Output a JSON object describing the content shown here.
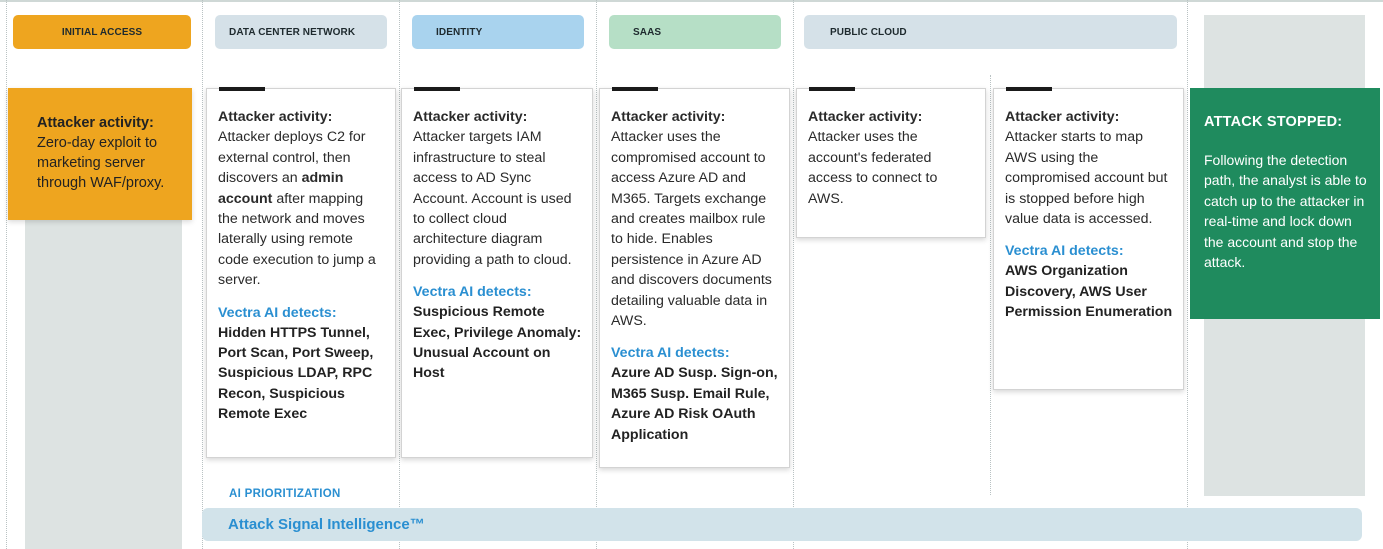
{
  "headers": [
    {
      "label": "INITIAL ACCESS",
      "color": "#eea51f"
    },
    {
      "label": "DATA CENTER NETWORK",
      "color": "#d5e1e8"
    },
    {
      "label": "IDENTITY",
      "color": "#a9d3ee"
    },
    {
      "label": "SAAS",
      "color": "#b6dfc6"
    },
    {
      "label": "PUBLIC CLOUD",
      "color": "#d5e1e8"
    }
  ],
  "initial_access": {
    "title": "Attacker activity:",
    "body": "Zero-day exploit to marketing server through WAF/proxy."
  },
  "data_center": {
    "title": "Attacker activity:",
    "body_1": "Attacker deploys C2 for external control, then discovers an ",
    "body_bold": "admin account",
    "body_2": " after mapping the network and moves laterally using remote code execution to jump a server.",
    "detect_label": "Vectra AI detects:",
    "detections": "Hidden HTTPS Tunnel, Port Scan, Port Sweep, Suspicious LDAP, RPC Recon, Suspicious Remote Exec"
  },
  "identity": {
    "title": "Attacker activity:",
    "body": "Attacker targets IAM infrastructure to steal access to AD Sync Account. Account is used to collect cloud architecture diagram providing a path to cloud.",
    "detect_label": "Vectra AI detects:",
    "detections": "Suspicious Remote Exec, Privilege Anomaly: Unusual Account on Host"
  },
  "saas": {
    "title": "Attacker activity:",
    "body": "Attacker uses the compromised account to access Azure AD and M365. Targets exchange and creates mailbox rule to hide. Enables persistence in Azure AD and discovers documents detailing valuable data in AWS.",
    "detect_label": "Vectra AI detects:",
    "detections": "Azure AD Susp. Sign-on, M365 Susp. Email Rule, Azure AD Risk OAuth Application"
  },
  "public_cloud_1": {
    "title": "Attacker activity:",
    "body": "Attacker uses the account's federated access to connect to AWS."
  },
  "public_cloud_2": {
    "title": "Attacker activity:",
    "body": "Attacker starts to map AWS using the compromised account but is stopped before high value data is accessed.",
    "detect_label": "Vectra AI detects:",
    "detections": "AWS Organization Discovery, AWS User Permission Enumeration"
  },
  "attack_stopped": {
    "title": "ATTACK STOPPED:",
    "body": "Following the detection path, the analyst is able to catch up to the attacker in real-time and lock down the account and stop the attack."
  },
  "footer": {
    "ai_label": "AI PRIORITIZATION",
    "signal_label": "Attack Signal Intelligence™"
  }
}
